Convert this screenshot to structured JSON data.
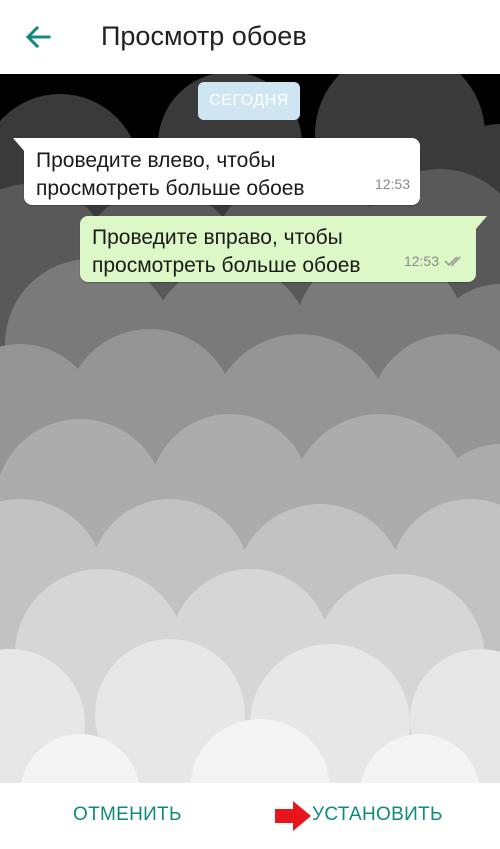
{
  "app_bar": {
    "title": "Просмотр обоев",
    "back_icon": "arrow-left-icon"
  },
  "chat": {
    "date_chip": "СЕГОДНЯ",
    "incoming": {
      "text_line1": "Проведите влево, чтобы",
      "text_line2": "просмотреть больше обоев",
      "time": "12:53"
    },
    "outgoing": {
      "text_line1": "Проведите вправо, чтобы",
      "text_line2": "просмотреть больше обоев",
      "time": "12:53",
      "status_icon": "double-check-icon"
    }
  },
  "actions": {
    "cancel_label": "ОТМЕНИТЬ",
    "set_label": "УСТАНОВИТЬ",
    "hint_icon": "red-arrow-right-icon"
  },
  "colors": {
    "accent": "#0f8a7b",
    "incoming_bubble": "#ffffff",
    "outgoing_bubble": "#dcf8c6",
    "date_chip": "#cfe6f2",
    "hint_arrow": "#e8151b"
  }
}
